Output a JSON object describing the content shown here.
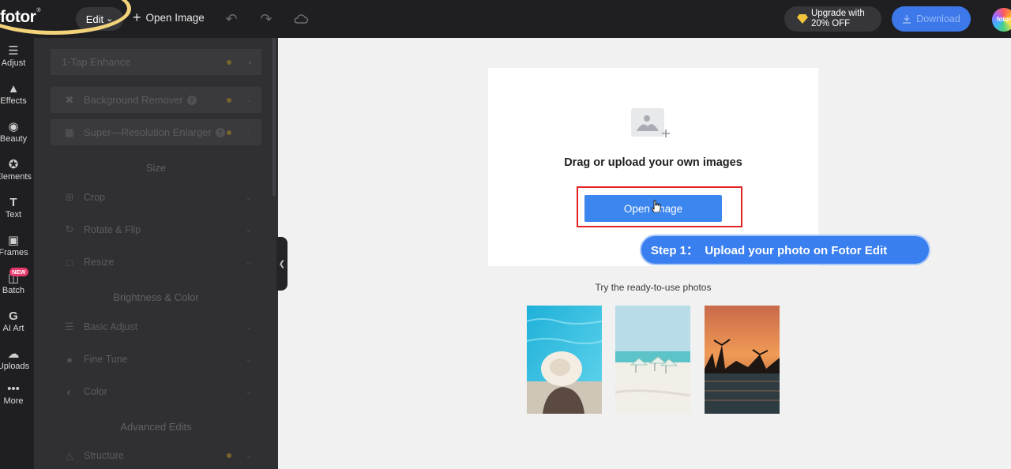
{
  "topbar": {
    "logo_text": "fotor",
    "logo_mark": "®",
    "edit_label": "Edit",
    "open_image_label": "Open Image",
    "upgrade_line1": "Upgrade with",
    "upgrade_line2": "20% OFF",
    "download_label": "Download",
    "avatar_text": "fotor"
  },
  "rail": {
    "items": [
      {
        "label": "Adjust",
        "icon": "sliders-icon"
      },
      {
        "label": "Effects",
        "icon": "flask-icon"
      },
      {
        "label": "Beauty",
        "icon": "eye-icon"
      },
      {
        "label": "Elements",
        "icon": "star-icon"
      },
      {
        "label": "Text",
        "icon": "text-icon"
      },
      {
        "label": "Frames",
        "icon": "frame-icon"
      },
      {
        "label": "Batch",
        "icon": "batch-icon"
      },
      {
        "label": "AI Art",
        "icon": "ai-art-icon"
      },
      {
        "label": "Uploads",
        "icon": "cloud-icon"
      },
      {
        "label": "More",
        "icon": "more-icon"
      }
    ],
    "new_badge": "NEW"
  },
  "panel": {
    "tools": [
      {
        "label": "1-Tap Enhance"
      },
      {
        "label": "Background Remover"
      },
      {
        "label": "Super—Resolution Enlarger"
      }
    ],
    "sections": [
      {
        "title": "Size",
        "items": [
          "Crop",
          "Rotate & Flip",
          "Resize"
        ]
      },
      {
        "title": "Brightness & Color",
        "items": [
          "Basic Adjust",
          "Fine Tune",
          "Color"
        ]
      },
      {
        "title": "Advanced Edits",
        "items": [
          "Structure"
        ]
      }
    ]
  },
  "canvas": {
    "drag_text": "Drag or upload your own images",
    "open_button": "Open Image",
    "step_text": "Step 1：  Upload your photo on Fotor Edit",
    "try_text": "Try the ready-to-use photos"
  },
  "colors": {
    "accent": "#3b86ef",
    "highlight_ellipse": "#f2d27a",
    "red_box": "#e32222",
    "topbar": "#1f1f22",
    "panel": "#303033"
  }
}
